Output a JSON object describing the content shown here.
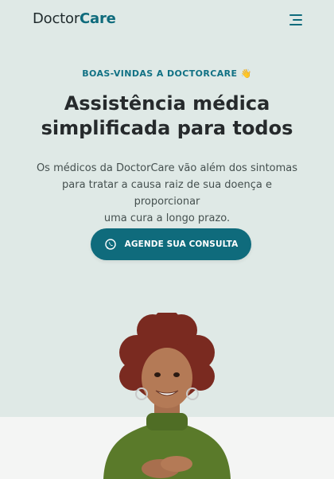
{
  "header": {
    "logo_part1": "Doctor",
    "logo_part2": "Care",
    "menu_icon": "hamburger-menu-icon"
  },
  "hero": {
    "eyebrow": "BOAS-VINDAS A DOCTORCARE 👋",
    "title_line1": "Assistência médica",
    "title_line2": "simplificada para todos",
    "desc_line1": "Os médicos da DoctorCare vão além dos sintomas",
    "desc_line2": "para tratar a causa raiz de sua doença e proporcionar",
    "desc_line3": "uma cura a longo prazo.",
    "cta_label": "AGENDE SUA CONSULTA",
    "cta_icon": "whatsapp-icon"
  },
  "colors": {
    "primary": "#0f6b7c",
    "background": "#dfe9e6",
    "band": "#f4f5f4"
  }
}
